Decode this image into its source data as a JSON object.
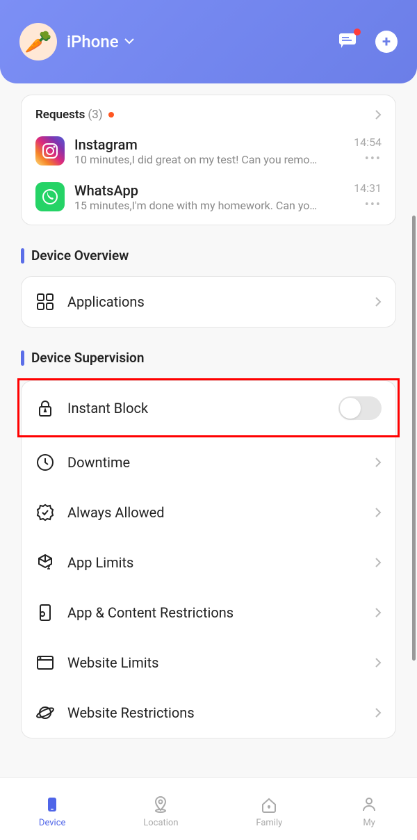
{
  "header": {
    "device_name": "iPhone",
    "avatar_emoji": "🥕"
  },
  "requests": {
    "title": "Requests",
    "count": "(3)",
    "items": [
      {
        "app": "Instagram",
        "message": "10 minutes,I did great on my test! Can you remo…",
        "time": "14:54"
      },
      {
        "app": "WhatsApp",
        "message": "15 minutes,I'm done with my homework. Can yo…",
        "time": "14:31"
      }
    ]
  },
  "sections": {
    "overview_title": "Device Overview",
    "supervision_title": "Device Supervision"
  },
  "overview": {
    "applications": "Applications"
  },
  "supervision": {
    "instant_block": "Instant Block",
    "downtime": "Downtime",
    "always_allowed": "Always Allowed",
    "app_limits": "App Limits",
    "app_content_restrictions": "App & Content Restrictions",
    "website_limits": "Website Limits",
    "website_restrictions": "Website Restrictions"
  },
  "nav": {
    "device": "Device",
    "location": "Location",
    "family": "Family",
    "my": "My"
  }
}
